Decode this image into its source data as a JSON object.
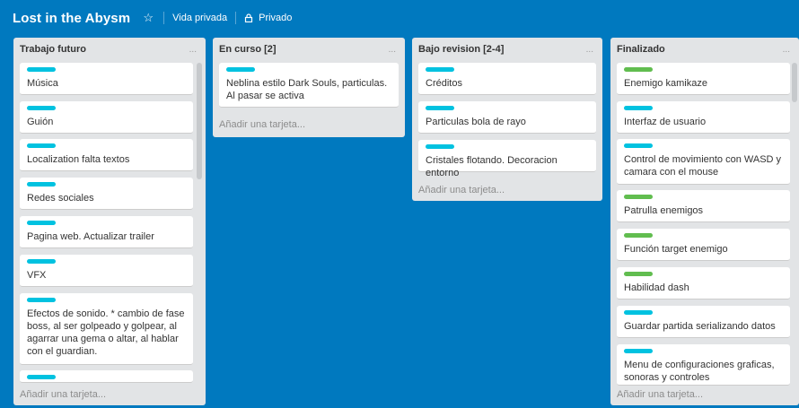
{
  "header": {
    "board_title": "Lost in the Abysm",
    "visibility": "Vida privada",
    "privacy": "Privado"
  },
  "colors": {
    "board_bg": "#0079bf",
    "label_blue": "#00c2e0",
    "label_green": "#61bd4f"
  },
  "lists": [
    {
      "title": "Trabajo futuro",
      "menu": "...",
      "add_card": "Añadir una tarjeta...",
      "cards": [
        {
          "label": "blue",
          "title": "Música"
        },
        {
          "label": "blue",
          "title": "Guión"
        },
        {
          "label": "blue",
          "title": "Localization falta textos"
        },
        {
          "label": "blue",
          "title": "Redes sociales"
        },
        {
          "label": "blue",
          "title": "Pagina web. Actualizar trailer"
        },
        {
          "label": "blue",
          "title": "VFX"
        },
        {
          "label": "blue",
          "title": "Efectos de sonido. * cambio de fase boss, al ser golpeado y golpear, al agarrar una gema o altar, al hablar con el guardian."
        },
        {
          "label": "blue",
          "title": ""
        }
      ]
    },
    {
      "title": "En curso [2]",
      "menu": "...",
      "add_card": "Añadir una tarjeta...",
      "cards": [
        {
          "label": "blue",
          "title": "Neblina estilo Dark Souls, particulas. Al pasar se activa"
        }
      ]
    },
    {
      "title": "Bajo revision [2-4]",
      "menu": "...",
      "add_card": "Añadir una tarjeta...",
      "cards": [
        {
          "label": "blue",
          "title": "Créditos"
        },
        {
          "label": "blue",
          "title": "Particulas bola de rayo"
        },
        {
          "label": "blue",
          "title": "Cristales flotando. Decoracion entorno"
        }
      ]
    },
    {
      "title": "Finalizado",
      "menu": "...",
      "add_card": "Añadir una tarjeta...",
      "cards": [
        {
          "label": "green",
          "title": "Enemigo kamikaze"
        },
        {
          "label": "blue",
          "title": "Interfaz de usuario"
        },
        {
          "label": "blue",
          "title": "Control de movimiento con WASD y camara con el mouse"
        },
        {
          "label": "green",
          "title": "Patrulla enemigos"
        },
        {
          "label": "green",
          "title": "Función target enemigo"
        },
        {
          "label": "green",
          "title": "Habilidad dash"
        },
        {
          "label": "blue",
          "title": "Guardar partida serializando datos"
        },
        {
          "label": "blue",
          "title": "Menu de configuraciones graficas, sonoras y controles"
        }
      ]
    }
  ]
}
